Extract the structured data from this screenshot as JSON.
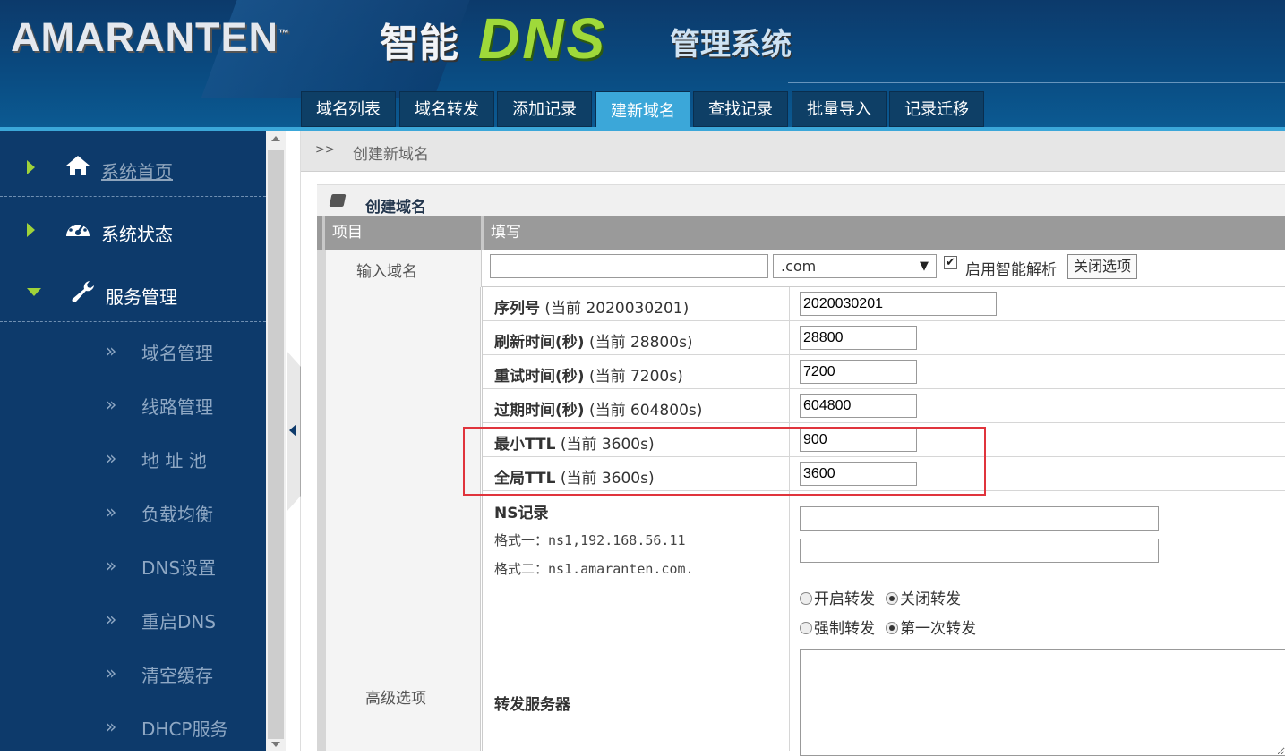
{
  "header": {
    "logo": "AMARANTEN",
    "tm": "™",
    "title_cn1": "智能",
    "title_dns": "DNS",
    "title_cn2": "管理系统"
  },
  "tabs": [
    {
      "label": "域名列表"
    },
    {
      "label": "域名转发"
    },
    {
      "label": "添加记录"
    },
    {
      "label": "建新域名",
      "active": true
    },
    {
      "label": "查找记录"
    },
    {
      "label": "批量导入"
    },
    {
      "label": "记录迁移"
    }
  ],
  "sidebar": {
    "menus": [
      {
        "label": "系统首页",
        "icon": "home-icon",
        "expanded": false
      },
      {
        "label": "系统状态",
        "icon": "dashboard-icon",
        "expanded": false
      },
      {
        "label": "服务管理",
        "icon": "wrench-icon",
        "expanded": true
      }
    ],
    "submenu_arrow": "»",
    "submenu": [
      {
        "label": "域名管理"
      },
      {
        "label": "线路管理"
      },
      {
        "label": "地 址 池"
      },
      {
        "label": "负载均衡"
      },
      {
        "label": "DNS设置"
      },
      {
        "label": "重启DNS"
      },
      {
        "label": "清空缓存"
      },
      {
        "label": "DHCP服务"
      }
    ]
  },
  "breadcrumb": {
    "sep": ">>",
    "text": "创建新域名"
  },
  "section": {
    "title": "创建域名"
  },
  "table": {
    "col_item": "项目",
    "col_fill": "填写",
    "domain_row": {
      "label": "输入域名",
      "value": "",
      "suffix": ".com",
      "smart_checked": true,
      "smart_label": "启用智能解析",
      "close_button": "关闭选项"
    },
    "advanced_label": "高级选项",
    "advanced": {
      "serial": {
        "label": "序列号",
        "hint": "(当前 2020030201)",
        "value": "2020030201"
      },
      "refresh": {
        "label": "刷新时间(秒)",
        "hint": "(当前 28800s)",
        "value": "28800"
      },
      "retry": {
        "label": "重试时间(秒)",
        "hint": "(当前 7200s)",
        "value": "7200"
      },
      "expire": {
        "label": "过期时间(秒)",
        "hint": "(当前 604800s)",
        "value": "604800"
      },
      "min_ttl": {
        "label": "最小TTL",
        "hint": "(当前 3600s)",
        "value": "900"
      },
      "global_ttl": {
        "label": "全局TTL",
        "hint": "(当前 3600s)",
        "value": "3600"
      },
      "ns": {
        "label": "NS记录",
        "format1": "格式一：ns1,192.168.56.11",
        "format2": "格式二：ns1.amaranten.com.",
        "value1": "",
        "value2": ""
      },
      "forward": {
        "label": "转发服务器",
        "opt_enable": "开启转发",
        "opt_disable": "关闭转发",
        "selected_switch": "关闭转发",
        "opt_force": "强制转发",
        "opt_first": "第一次转发",
        "selected_mode": "第一次转发"
      }
    }
  },
  "colors": {
    "header_bg": "#0c3a6b",
    "tab_bg": "#0e3f66",
    "tab_active": "#3ba7d9",
    "sidebar_bg": "#0d3a6b",
    "accent_green": "#9fd23a",
    "highlight_red": "#e0343c"
  }
}
